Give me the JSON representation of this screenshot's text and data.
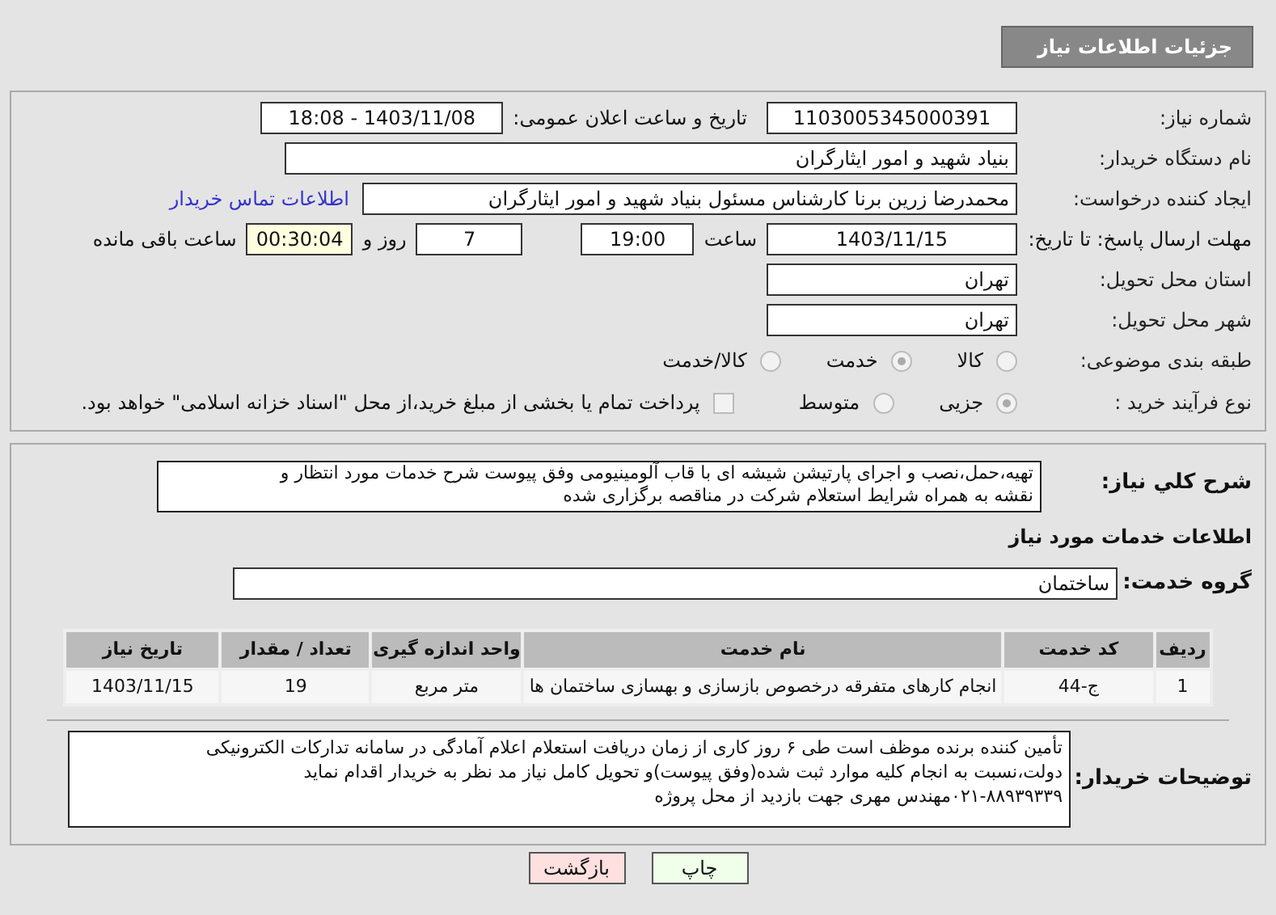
{
  "header": {
    "title": "جزئیات اطلاعات نیاز"
  },
  "need_number": {
    "label": "شماره نیاز:",
    "value": "1103005345000391"
  },
  "announce": {
    "label": "تاریخ و ساعت اعلان عمومی:",
    "value": "1403/11/08 - 18:08"
  },
  "buyer_org": {
    "label": "نام دستگاه خریدار:",
    "value": "بنیاد شهید و امور ایثارگران"
  },
  "requester": {
    "label": "ایجاد کننده درخواست:",
    "value": "محمدرضا زرین برنا کارشناس مسئول  بنیاد شهید و امور ایثارگران",
    "link": "اطلاعات تماس خریدار"
  },
  "deadline": {
    "label": "مهلت ارسال پاسخ: تا تاریخ:",
    "date": "1403/11/15",
    "time_label": "ساعت",
    "time": "19:00",
    "days": "7",
    "days_label": "روز و",
    "remaining": "00:30:04",
    "remaining_label": "ساعت باقی مانده"
  },
  "province": {
    "label": "استان محل تحویل:",
    "value": "تهران"
  },
  "city": {
    "label": "شهر محل تحویل:",
    "value": "تهران"
  },
  "category": {
    "label": "طبقه بندی موضوعی:",
    "options": [
      {
        "label": "کالا",
        "selected": false
      },
      {
        "label": "خدمت",
        "selected": true
      },
      {
        "label": "کالا/خدمت",
        "selected": false
      }
    ]
  },
  "process": {
    "label": "نوع فرآیند خرید :",
    "options": [
      {
        "label": "جزیی",
        "selected": true
      },
      {
        "label": "متوسط",
        "selected": false
      }
    ],
    "payment": {
      "label": "پرداخت تمام یا بخشی از مبلغ خرید،از محل \"اسناد خزانه اسلامی\" خواهد بود.",
      "checked": false
    }
  },
  "description": {
    "label": "شرح کلي نیاز:",
    "lines": [
      "تهیه،حمل،نصب و اجرای پارتیشن شیشه ای با قاب آلومینیومی وفق پیوست شرح خدمات مورد انتظار و",
      "نقشه به همراه شرایط استعلام شرکت در مناقصه برگزاری شده"
    ]
  },
  "services_heading": "اطلاعات خدمات مورد نیاز",
  "service_group": {
    "label": "گروه خدمت:",
    "value": "ساختمان"
  },
  "table": {
    "columns": [
      "ردیف",
      "کد خدمت",
      "نام خدمت",
      "واحد اندازه گیری",
      "تعداد / مقدار",
      "تاریخ نیاز"
    ],
    "rows": [
      [
        "1",
        "ج-44",
        "انجام کارهای متفرقه درخصوص بازسازی و بهسازی ساختمان ها",
        "متر مربع",
        "19",
        "1403/11/15"
      ]
    ]
  },
  "buyer_notes": {
    "label": "توضیحات خریدار:",
    "lines": [
      "تأمین کننده برنده موظف است طی ۶ روز کاری از زمان دریافت استعلام اعلام آمادگی در سامانه تدارکات الکترونیکی",
      "دولت،نسبت به انجام کلیه موارد ثبت شده(وفق پیوست)و تحویل کامل نیاز مد نظر به خریدار اقدام نماید",
      "۰۲۱-۸۸۹۳۹۳۳۹مهندس مهری جهت بازدید از محل پروژه"
    ]
  },
  "buttons": [
    {
      "label": "چاپ",
      "kind": "print"
    },
    {
      "label": "بازگشت",
      "kind": "back"
    }
  ]
}
